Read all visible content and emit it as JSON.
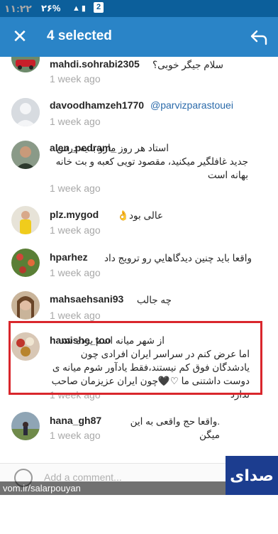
{
  "statusbar": {
    "time": "۱۱:۲۲",
    "battery": "۲۶%",
    "notif": "2"
  },
  "actionbar": {
    "title": "4 selected"
  },
  "comments": [
    {
      "user": "mahdi.sohrabi2305",
      "text": "سلام جیگر خوبی؟",
      "time": "1 week ago"
    },
    {
      "user": "davoodhamzeh1770",
      "mention": "@parvizparastouei",
      "time": "1 week ago"
    },
    {
      "user": "alen_pedram_",
      "text": "استاد هر روز مارو با یه درس جدید غافلگیر میکنید، مقصود تویی کعبه و بت خانه بهانه است",
      "time": "1 week ago"
    },
    {
      "user": "plz.mygod",
      "text": "عالی بود👌",
      "time": "1 week ago"
    },
    {
      "user": "hparhez",
      "text": "واقعا بايد چنين ديدگاهايي رو ترويج داد",
      "time": "1 week ago"
    },
    {
      "user": "mahsaehsani93",
      "text": "چه جالب",
      "time": "1 week ago"
    },
    {
      "user": "hamishe_too",
      "text": "از شهر میانه اسم برده شد اما عرض کنم در سراسر ایران افرادی چون یادشدگان فوق کم نیستند،فقط یادآور شوم میانه ی دوست داشتنی ما ♡🖤چون ایران عزیزمان صاحب ندارد",
      "time": "1 week ago"
    },
    {
      "user": "hana_gh87",
      "text": ".واقعا حج واقعی به این میگن",
      "time": "1 week ago"
    }
  ],
  "footer": {
    "placeholder": "Add a comment..."
  },
  "watermark": "vom.ir/salarpouyan",
  "logo_text": "صدای میانه"
}
